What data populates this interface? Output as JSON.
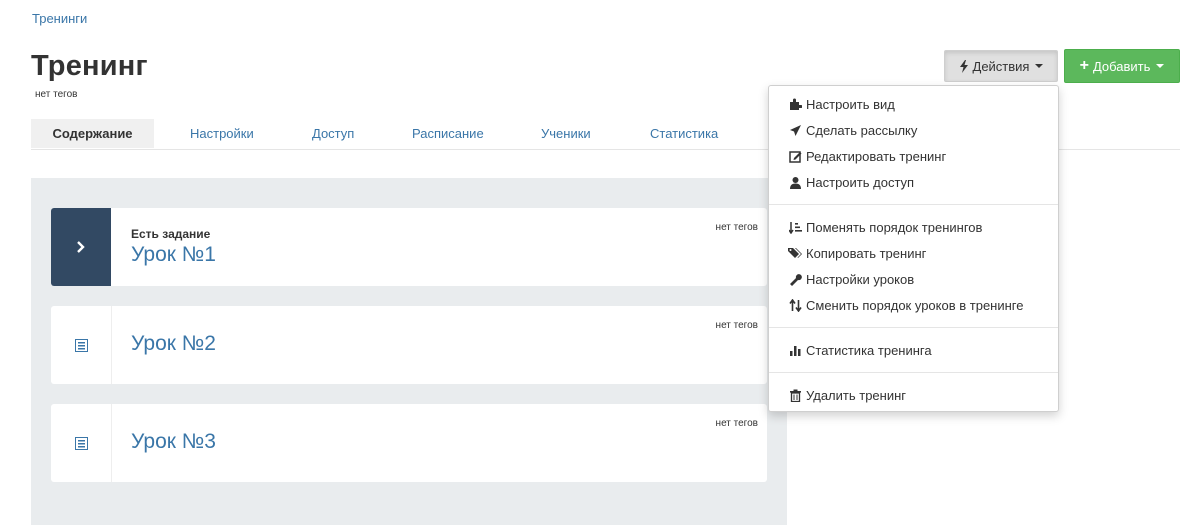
{
  "breadcrumb": "Тренинги",
  "page": {
    "title": "Тренинг",
    "tags": "нет тегов"
  },
  "buttons": {
    "actions": "Действия",
    "add": "Добавить"
  },
  "tabs": [
    "Содержание",
    "Настройки",
    "Доступ",
    "Расписание",
    "Ученики",
    "Статистика"
  ],
  "lessons": [
    {
      "subtitle": "Есть задание",
      "title": "Урок №1",
      "tags": "нет тегов"
    },
    {
      "subtitle": "",
      "title": "Урок №2",
      "tags": "нет тегов"
    },
    {
      "subtitle": "",
      "title": "Урок №3",
      "tags": "нет тегов"
    }
  ],
  "menu": [
    {
      "label": "Настроить вид",
      "icon": "puzzle-icon"
    },
    {
      "label": "Сделать рассылку",
      "icon": "send-icon"
    },
    {
      "label": "Редактировать тренинг",
      "icon": "edit-icon"
    },
    {
      "label": "Настроить доступ",
      "icon": "user-icon"
    },
    {
      "label": "Поменять порядок тренингов",
      "icon": "sort-order-icon"
    },
    {
      "label": "Копировать тренинг",
      "icon": "tags-icon"
    },
    {
      "label": "Настройки уроков",
      "icon": "wrench-icon"
    },
    {
      "label": "Сменить порядок уроков в тренинге",
      "icon": "sort-arrows-icon"
    },
    {
      "label": "Статистика тренинга",
      "icon": "bar-chart-icon"
    },
    {
      "label": "Удалить тренинг",
      "icon": "trash-icon"
    }
  ],
  "colors": {
    "link": "#3a76a8",
    "success": "#5cb85c",
    "dark_side": "#324963",
    "panel_bg": "#e9ecee"
  }
}
